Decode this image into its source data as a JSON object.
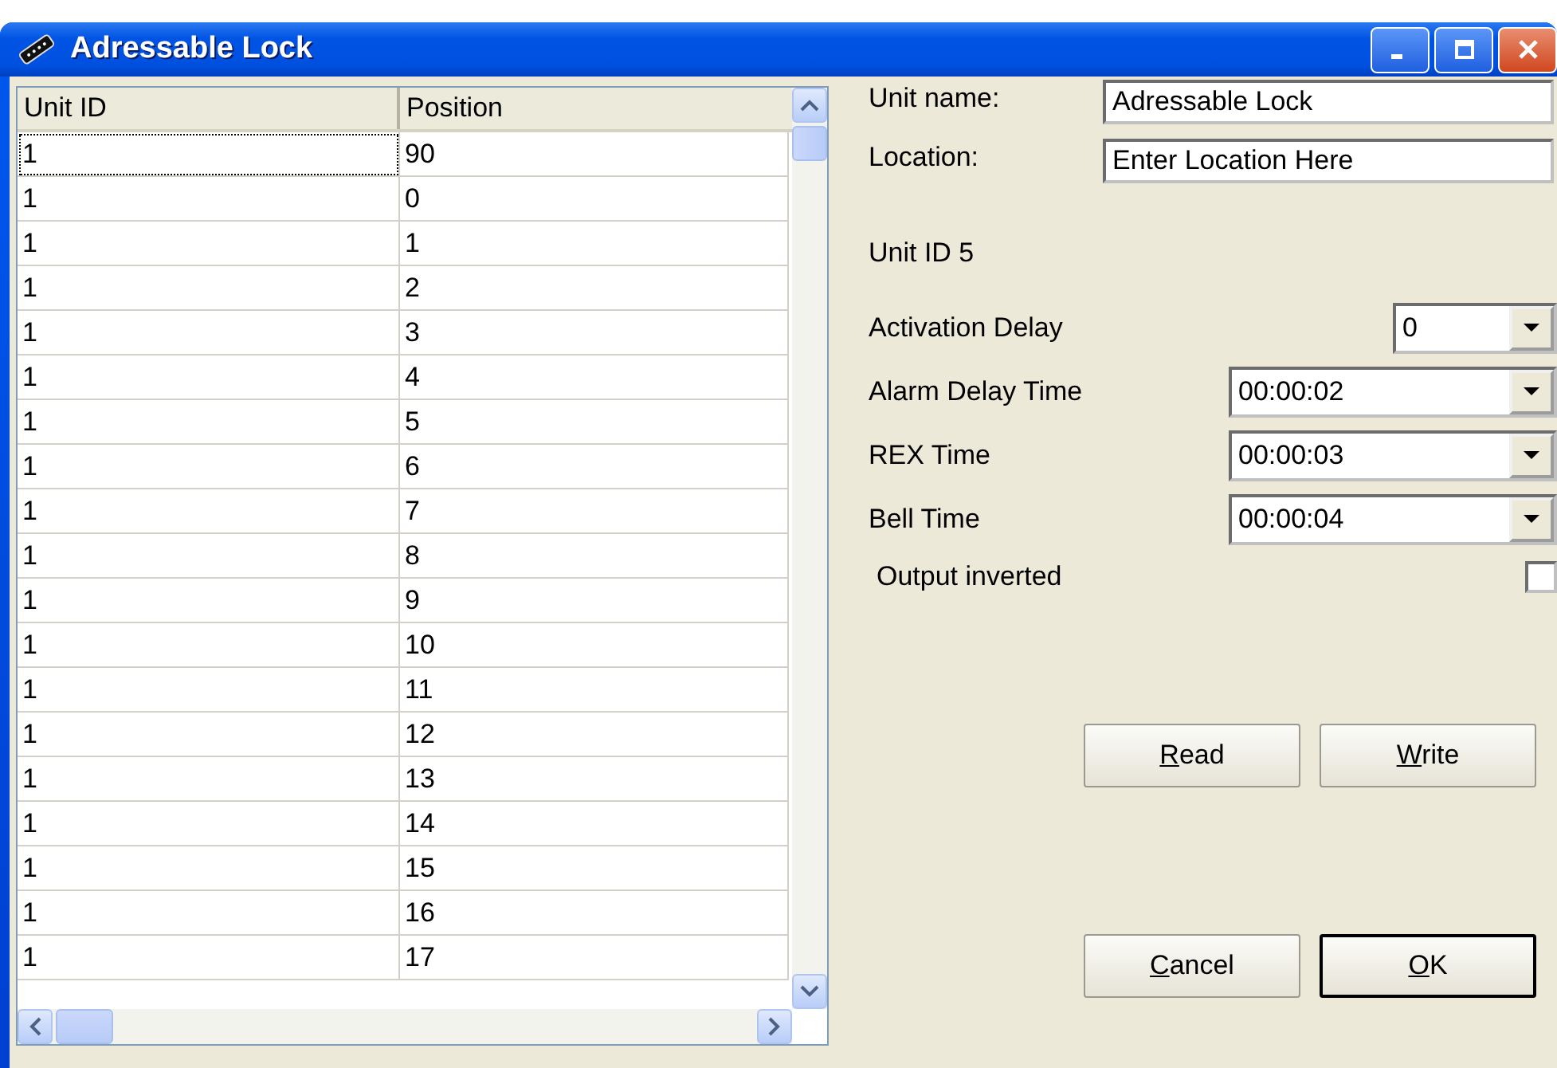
{
  "window": {
    "title": "Adressable Lock"
  },
  "table": {
    "columns": [
      "Unit ID",
      "Position"
    ],
    "rows": [
      {
        "cells": [
          "1",
          "90"
        ],
        "focused": true
      },
      {
        "cells": [
          "1",
          "0"
        ],
        "focused": false
      },
      {
        "cells": [
          "1",
          "1"
        ],
        "focused": false
      },
      {
        "cells": [
          "1",
          "2"
        ],
        "focused": false
      },
      {
        "cells": [
          "1",
          "3"
        ],
        "focused": false
      },
      {
        "cells": [
          "1",
          "4"
        ],
        "focused": false
      },
      {
        "cells": [
          "1",
          "5"
        ],
        "focused": false
      },
      {
        "cells": [
          "1",
          "6"
        ],
        "focused": false
      },
      {
        "cells": [
          "1",
          "7"
        ],
        "focused": false
      },
      {
        "cells": [
          "1",
          "8"
        ],
        "focused": false
      },
      {
        "cells": [
          "1",
          "9"
        ],
        "focused": false
      },
      {
        "cells": [
          "1",
          "10"
        ],
        "focused": false
      },
      {
        "cells": [
          "1",
          "11"
        ],
        "focused": false
      },
      {
        "cells": [
          "1",
          "12"
        ],
        "focused": false
      },
      {
        "cells": [
          "1",
          "13"
        ],
        "focused": false
      },
      {
        "cells": [
          "1",
          "14"
        ],
        "focused": false
      },
      {
        "cells": [
          "1",
          "15"
        ],
        "focused": false
      },
      {
        "cells": [
          "1",
          "16"
        ],
        "focused": false
      },
      {
        "cells": [
          "1",
          "17"
        ],
        "focused": false
      }
    ]
  },
  "fields": [
    {
      "label": "Unit name:",
      "value": "Adressable Lock"
    },
    {
      "label": "Location:",
      "value": "Enter Location Here"
    }
  ],
  "unit_id": "Unit ID 5",
  "settings": [
    {
      "label": "Activation Delay",
      "value": "0",
      "kind": "number"
    },
    {
      "label": "Alarm Delay Time",
      "value": "00:00:02",
      "kind": "time"
    },
    {
      "label": "REX Time",
      "value": "00:00:03",
      "kind": "time"
    },
    {
      "label": "Bell Time",
      "value": "00:00:04",
      "kind": "time"
    }
  ],
  "option": {
    "label": "Output inverted",
    "checked": false
  },
  "buttons_top": [
    {
      "label": "Read",
      "mnemonic": true,
      "default": false
    },
    {
      "label": "Write",
      "mnemonic": true,
      "default": false
    }
  ],
  "buttons_bottom": [
    {
      "label": "Cancel",
      "mnemonic": true,
      "default": false
    },
    {
      "label": "OK",
      "mnemonic": true,
      "default": true
    }
  ]
}
